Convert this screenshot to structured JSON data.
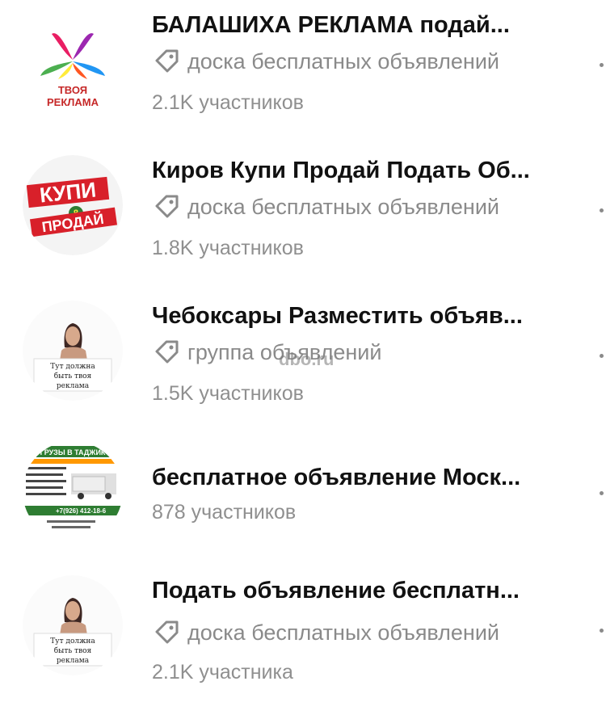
{
  "groups": [
    {
      "title": "БАЛАШИХА РЕКЛАМА подай...",
      "tag": "доска бесплатных объявлений",
      "members": "2.1K участников",
      "avatar": {
        "type": "logo",
        "line1": "ТВОЯ",
        "line2": "РЕКЛАМА",
        "colors": [
          "#e91e63",
          "#2196f3",
          "#ffeb3b",
          "#4caf50",
          "#ff5722",
          "#9c27b0"
        ]
      }
    },
    {
      "title": "Киров Купи Продай Подать Об...",
      "tag": "доска бесплатных объявлений",
      "members": "1.8K участников",
      "avatar": {
        "type": "text-logo",
        "word1": "КУПИ",
        "amp": "&",
        "word2": "ПРОДАЙ",
        "color": "#d8202a"
      }
    },
    {
      "title": "Чебоксары Разместить объяв...",
      "tag": "группа объявлений",
      "members": "1.5K участников",
      "avatar": {
        "type": "photo-sign",
        "sign": [
          "Тут должна",
          "быть твоя",
          "реклама"
        ]
      }
    },
    {
      "title": "бесплатное объявление Моск...",
      "tag": "",
      "members": "878 участников",
      "avatar": {
        "type": "ad-banner",
        "header": "ГРУЗЫ В ТАДЖИК",
        "phone": "+7(926) 412-18-6"
      }
    },
    {
      "title": "Подать объявление бесплатн...",
      "tag": "доска бесплатных объявлений",
      "members": "2.1K участника",
      "avatar": {
        "type": "photo-sign",
        "sign": [
          "Тут должна",
          "быть твоя",
          "реклама"
        ]
      }
    }
  ],
  "watermark": "dbo.ru",
  "icons": {
    "tag": "tag-icon",
    "more": "more-icon"
  }
}
